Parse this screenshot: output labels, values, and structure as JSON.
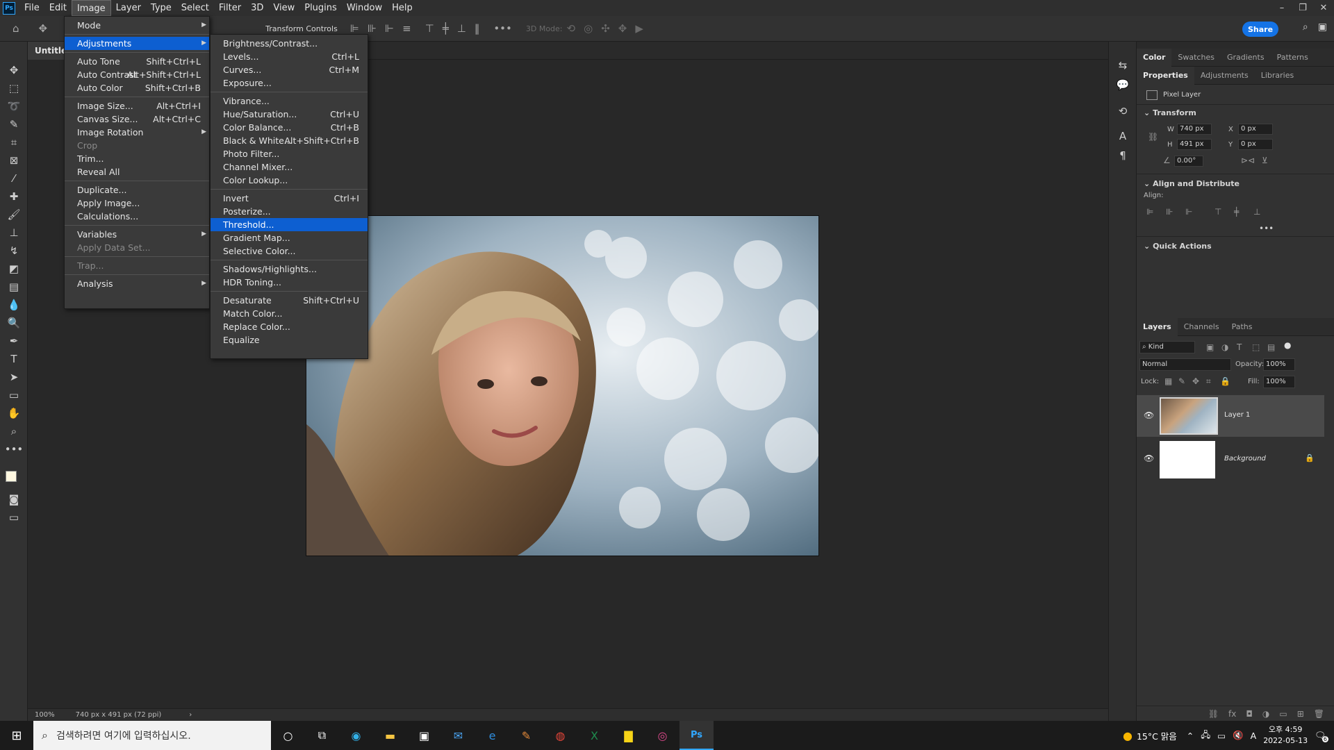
{
  "app": {
    "logo": "Ps"
  },
  "menubar": {
    "items": [
      "File",
      "Edit",
      "Image",
      "Layer",
      "Type",
      "Select",
      "Filter",
      "3D",
      "View",
      "Plugins",
      "Window",
      "Help"
    ],
    "active": "Image"
  },
  "window_controls": {
    "minimize": "–",
    "restore": "❐",
    "close": "✕"
  },
  "options_bar": {
    "transform_label": "Transform Controls",
    "mode_label": "3D Mode:",
    "share": "Share"
  },
  "document": {
    "tab_title": "Untitled",
    "zoom": "100%",
    "size_info": "740 px x 491 px (72 ppi)"
  },
  "image_menu": [
    {
      "label": "Mode",
      "submenu": true
    },
    {
      "sep": true
    },
    {
      "label": "Adjustments",
      "submenu": true,
      "highlight": true
    },
    {
      "sep": true
    },
    {
      "label": "Auto Tone",
      "shortcut": "Shift+Ctrl+L"
    },
    {
      "label": "Auto Contrast",
      "shortcut": "Alt+Shift+Ctrl+L"
    },
    {
      "label": "Auto Color",
      "shortcut": "Shift+Ctrl+B"
    },
    {
      "sep": true
    },
    {
      "label": "Image Size...",
      "shortcut": "Alt+Ctrl+I"
    },
    {
      "label": "Canvas Size...",
      "shortcut": "Alt+Ctrl+C"
    },
    {
      "label": "Image Rotation",
      "submenu": true
    },
    {
      "label": "Crop",
      "disabled": true
    },
    {
      "label": "Trim..."
    },
    {
      "label": "Reveal All"
    },
    {
      "sep": true
    },
    {
      "label": "Duplicate..."
    },
    {
      "label": "Apply Image..."
    },
    {
      "label": "Calculations..."
    },
    {
      "sep": true
    },
    {
      "label": "Variables",
      "submenu": true
    },
    {
      "label": "Apply Data Set...",
      "disabled": true
    },
    {
      "sep": true
    },
    {
      "label": "Trap...",
      "disabled": true
    },
    {
      "sep": true
    },
    {
      "label": "Analysis",
      "submenu": true
    }
  ],
  "adjustments_menu": [
    {
      "label": "Brightness/Contrast..."
    },
    {
      "label": "Levels...",
      "shortcut": "Ctrl+L"
    },
    {
      "label": "Curves...",
      "shortcut": "Ctrl+M"
    },
    {
      "label": "Exposure..."
    },
    {
      "sep": true
    },
    {
      "label": "Vibrance..."
    },
    {
      "label": "Hue/Saturation...",
      "shortcut": "Ctrl+U"
    },
    {
      "label": "Color Balance...",
      "shortcut": "Ctrl+B"
    },
    {
      "label": "Black & White...",
      "shortcut": "Alt+Shift+Ctrl+B"
    },
    {
      "label": "Photo Filter..."
    },
    {
      "label": "Channel Mixer..."
    },
    {
      "label": "Color Lookup..."
    },
    {
      "sep": true
    },
    {
      "label": "Invert",
      "shortcut": "Ctrl+I"
    },
    {
      "label": "Posterize..."
    },
    {
      "label": "Threshold...",
      "highlight": true
    },
    {
      "label": "Gradient Map..."
    },
    {
      "label": "Selective Color..."
    },
    {
      "sep": true
    },
    {
      "label": "Shadows/Highlights..."
    },
    {
      "label": "HDR Toning..."
    },
    {
      "sep": true
    },
    {
      "label": "Desaturate",
      "shortcut": "Shift+Ctrl+U"
    },
    {
      "label": "Match Color..."
    },
    {
      "label": "Replace Color..."
    },
    {
      "label": "Equalize"
    }
  ],
  "panels": {
    "top_tabs": [
      "Color",
      "Swatches",
      "Gradients",
      "Patterns"
    ],
    "prop_tabs": [
      "Properties",
      "Adjustments",
      "Libraries"
    ],
    "pixel_layer": "Pixel Layer",
    "transform": {
      "title": "Transform",
      "w_label": "W",
      "w": "740 px",
      "h_label": "H",
      "h": "491 px",
      "x_label": "X",
      "x": "0 px",
      "y_label": "Y",
      "y": "0 px",
      "angle": "0.00°"
    },
    "align": {
      "title": "Align and Distribute",
      "label": "Align:",
      "more": "•••"
    },
    "quick_actions": "Quick Actions",
    "layer_tabs": [
      "Layers",
      "Channels",
      "Paths"
    ],
    "kind": "Kind",
    "blend": "Normal",
    "opacity_label": "Opacity:",
    "opacity": "100%",
    "lock_label": "Lock:",
    "fill_label": "Fill:",
    "fill": "100%",
    "layers": [
      {
        "name": "Layer 1",
        "selected": true
      },
      {
        "name": "Background",
        "locked": true
      }
    ]
  },
  "taskbar": {
    "search_placeholder": "검색하려면 여기에 입력하십시오.",
    "weather": "15°C 맑음",
    "time": "오후 4:59",
    "date": "2022-05-13",
    "ime": "A",
    "notif_count": "6"
  }
}
